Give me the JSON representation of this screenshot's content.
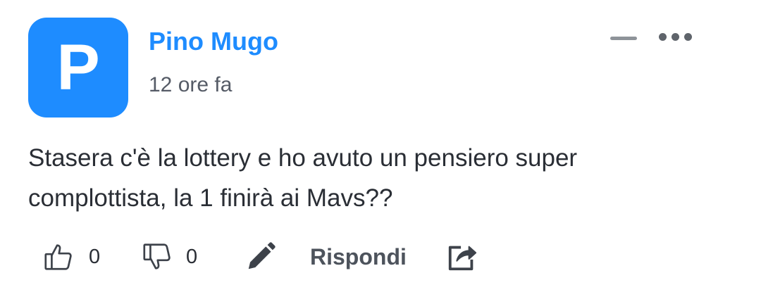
{
  "comment": {
    "avatar_letter": "P",
    "author": "Pino Mugo",
    "time": "12 ore fa",
    "text": "Stasera c'è la lottery e ho avuto un pensiero super complottista, la 1 finirà ai Mavs??"
  },
  "actions": {
    "like_count": "0",
    "dislike_count": "0",
    "reply_label": "Rispondi"
  },
  "icons": {
    "like": "thumbs-up-icon",
    "dislike": "thumbs-down-icon",
    "edit": "pencil-icon",
    "share": "share-icon",
    "minimize": "minimize-icon",
    "more": "more-dots-icon"
  },
  "colors": {
    "accent": "#1e8cff",
    "text": "#2a2e35",
    "muted": "#555b66"
  }
}
